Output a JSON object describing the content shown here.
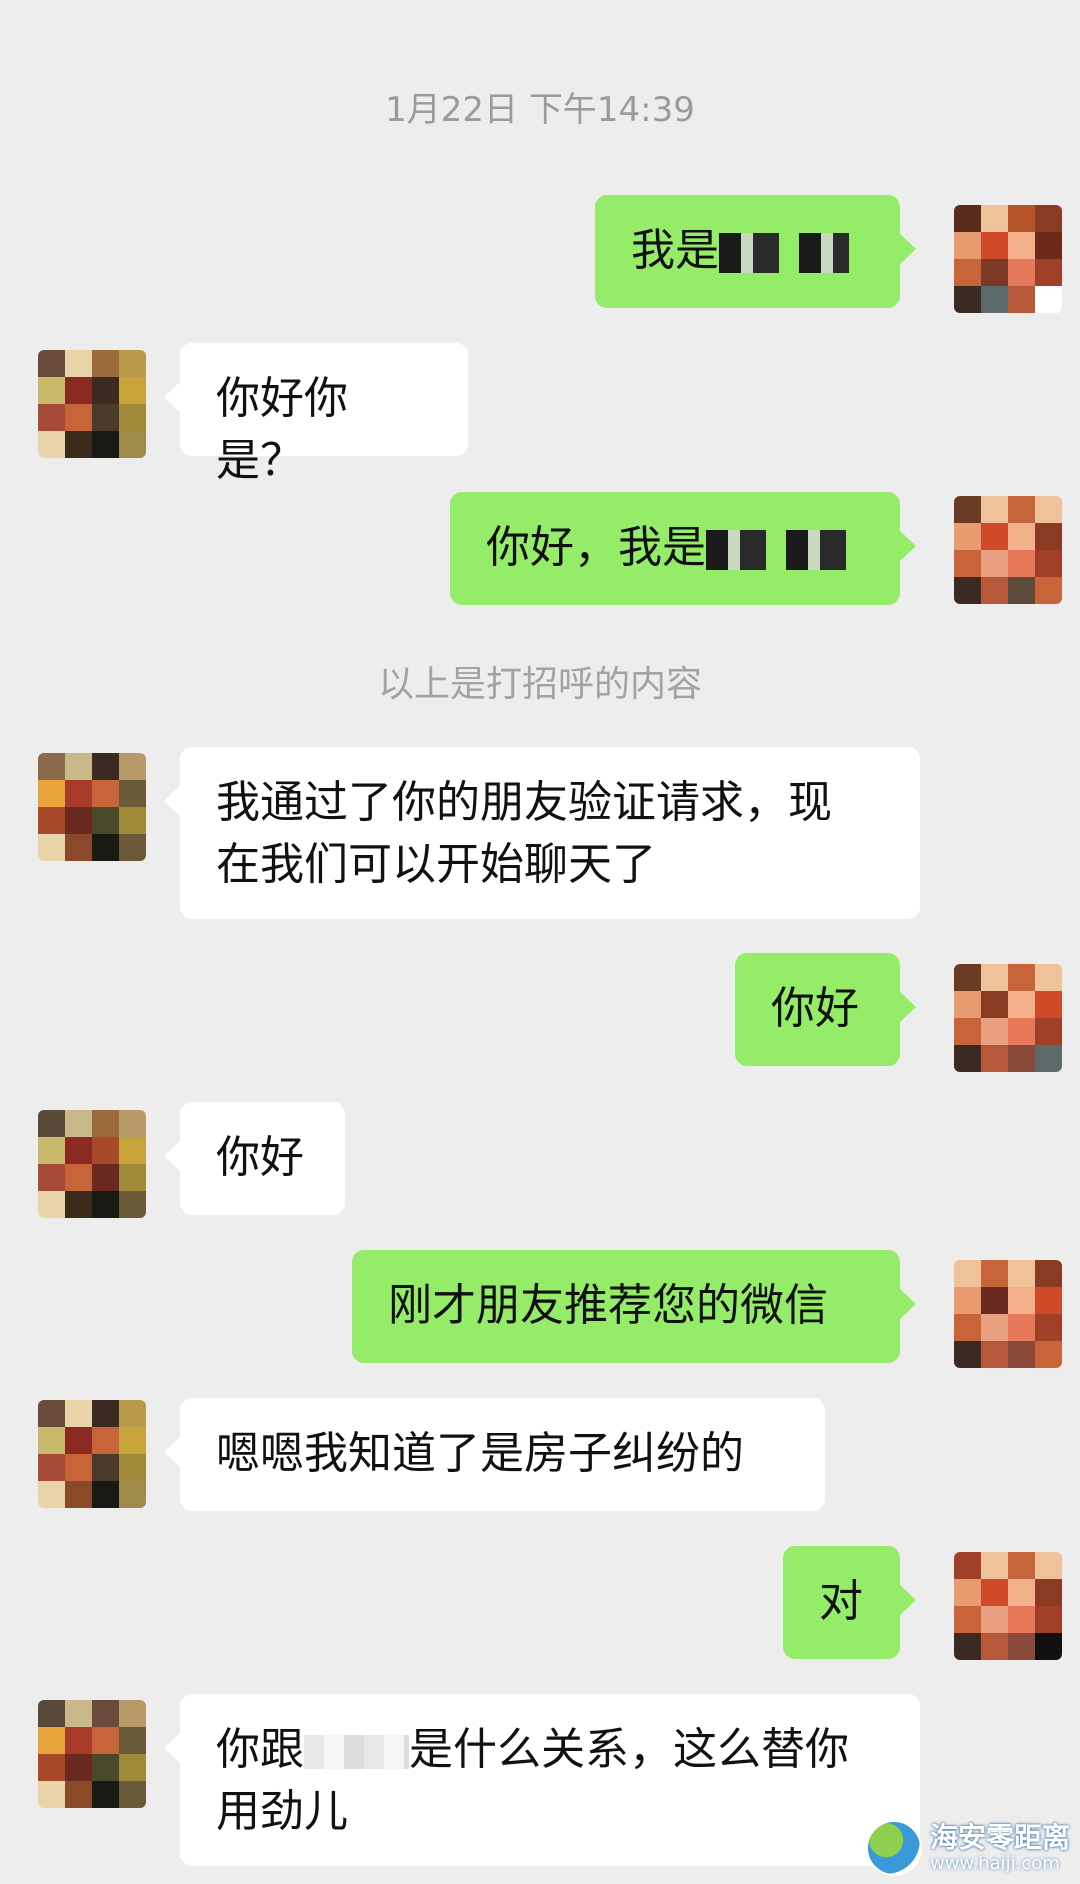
{
  "timestamp": "1月22日 下午14:39",
  "system_note": "以上是打招呼的内容",
  "messages": [
    {
      "side": "right",
      "text": "我是"
    },
    {
      "side": "left",
      "text": "你好你是？"
    },
    {
      "side": "right",
      "text": "你好，我是"
    },
    {
      "side": "left",
      "text": "我通过了你的朋友验证请求，现在我们可以开始聊天了",
      "line1": "我通过了你的朋友验证请求，现",
      "line2": "在我们可以开始聊天了"
    },
    {
      "side": "right",
      "text": "你好"
    },
    {
      "side": "left",
      "text": "你好"
    },
    {
      "side": "right",
      "text": "刚才朋友推荐您的微信"
    },
    {
      "side": "left",
      "text": "嗯嗯我知道了是房子纠纷的"
    },
    {
      "side": "right",
      "text": "对"
    },
    {
      "side": "left",
      "text": "你跟是什么关系，这么替你用劲儿",
      "part1": "你跟",
      "part2": "是什么关系，这么替你",
      "line2": "用劲儿"
    }
  ],
  "watermark": {
    "name": "海安零距离",
    "url": "www.haiji.com"
  },
  "colors": {
    "background": "#ededed",
    "sent_bubble": "#95ec69",
    "received_bubble": "#ffffff",
    "timestamp_text": "#9b9b9b"
  }
}
